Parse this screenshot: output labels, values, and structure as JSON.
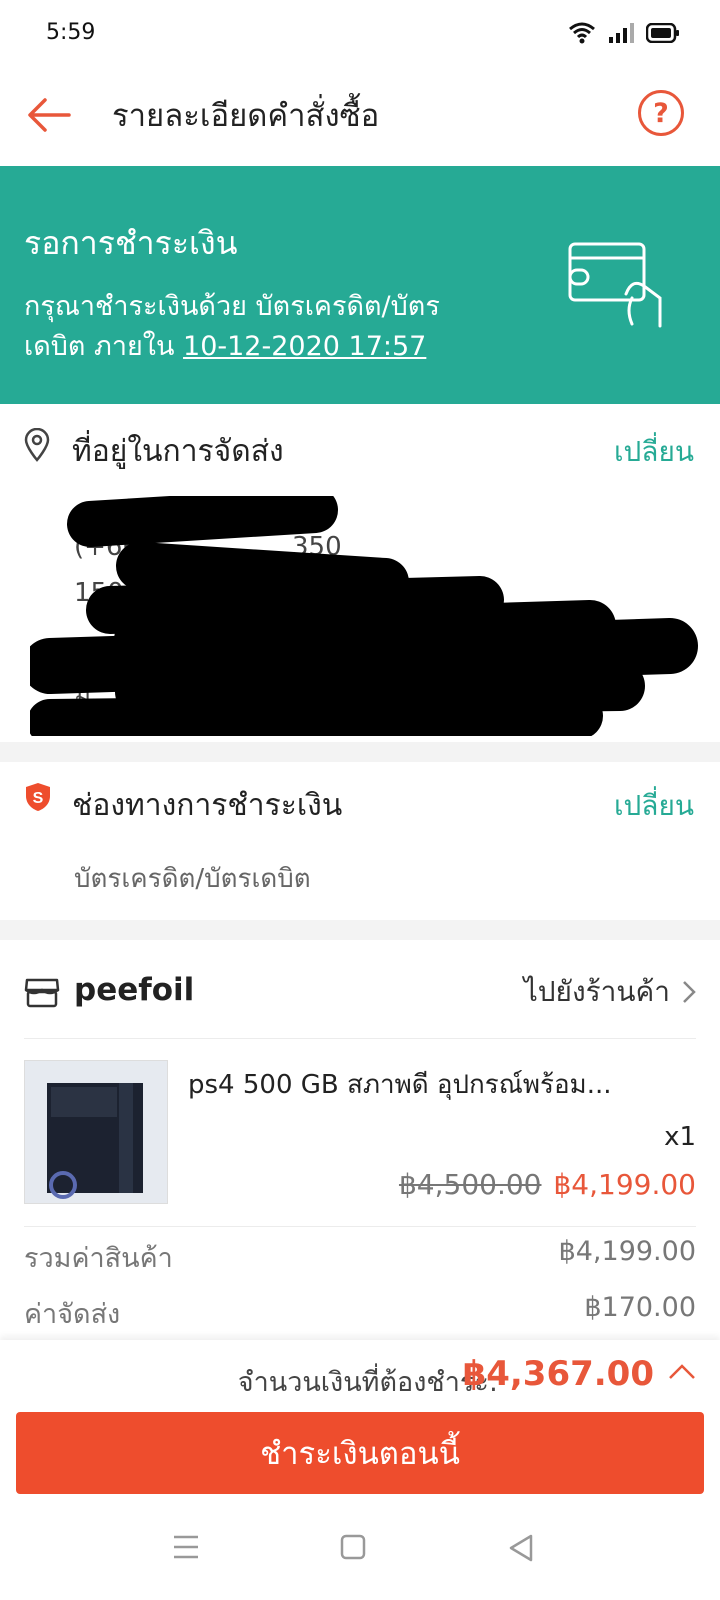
{
  "status_bar": {
    "time": "5:59"
  },
  "header": {
    "title": "รายละเอียดคำสั่งซื้อ",
    "help_symbol": "?"
  },
  "banner": {
    "title": "รอการชำระเงิน",
    "line1": "กรุณาชำระเงินด้วย บัตรเครดิต/บัตร",
    "line2_prefix": "เดบิต ภายใน ",
    "deadline": "10-12-2020 17:57",
    "icon": "card-in-hand-icon"
  },
  "address": {
    "title": "ที่อยู่ในการจัดส่ง",
    "change_label": "เปลี่ยน",
    "line_fragments": [
      "(+66",
      "350",
      "150",
      "ง",
      "ม"
    ]
  },
  "payment": {
    "title": "ช่องทางการชำระเงิน",
    "change_label": "เปลี่ยน",
    "method": "บัตรเครดิต/บัตรเดบิต"
  },
  "shop": {
    "name": "peefoil",
    "go_to_shop": "ไปยังร้านค้า",
    "product": {
      "name": "ps4  500 GB สภาพดี อุปกรณ์พร้อม...",
      "qty": "x1",
      "original_price": "฿4,500.00",
      "price": "฿4,199.00"
    },
    "summary": [
      {
        "label": "รวมค่าสินค้า",
        "value": "฿4,199.00"
      },
      {
        "label": "ค่าจัดส่ง",
        "value": "฿170.00"
      }
    ]
  },
  "bottom": {
    "total_label": "จำนวนเงินที่ต้องชำระ:",
    "total_value": "฿4,367.00",
    "pay_button": "ชำระเงินตอนนี้"
  },
  "colors": {
    "accent": "#ee4d2d",
    "teal": "#26aa95"
  }
}
